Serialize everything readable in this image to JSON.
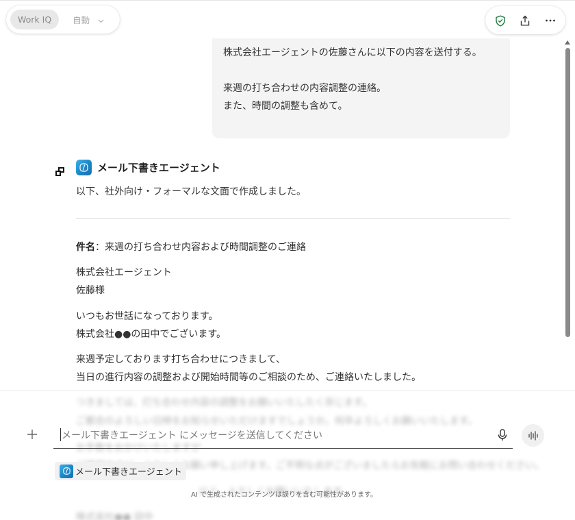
{
  "header": {
    "mode_label": "Work IQ",
    "model_label": "自動",
    "actions": [
      "shield-check-icon",
      "share-icon",
      "more-icon"
    ]
  },
  "user_message": {
    "lines": [
      "株式会社エージェントの佐藤さんに以下の内容を送付する。",
      "来週の打ち合わせの内容調整の連絡。",
      "また、時間の調整も含めて。"
    ]
  },
  "agent": {
    "name": "メール下書きエージェント",
    "intro": "以下、社外向け・フォーマルな文面で作成しました。",
    "subject_label": "件名",
    "subject_text": "：来週の打ち合わせ内容および時間調整のご連絡",
    "body_lines": [
      "株式会社エージェント",
      "佐藤様",
      "いつもお世話になっております。",
      "株式会社●●の田中でございます。",
      "来週予定しております打ち合わせにつきまして、",
      "当日の進行内容の調整および開始時間等のご相談のため、ご連絡いたしました。"
    ],
    "faded_lines": [
      "つきましては、打ち合わせ内容の調整をお願いいたしたく存じます。",
      "ご都合のよろしい日時をお知らせいただけますでしょうか。何卒よろしくお願いいたします。",
      "お手数をおかけいたしますが",
      "ご確認のほど、よろしくお願い申し上げます。ご不明な点がございましたらお気軽にお問い合わせください。",
      "以上、よろしくお願いいたします。",
      "株式会社●● 田中"
    ]
  },
  "composer": {
    "placeholder": "メール下書きエージェント にメッセージを送信してください",
    "agent_chip": "メール下書きエージェント",
    "disclaimer": "AI で生成されたコンテンツは誤りを含む可能性があります。"
  },
  "colors": {
    "agent_gradient_start": "#3db1e6",
    "agent_gradient_end": "#1a6fb4",
    "shield_green": "#1e7b3c",
    "bubble_bg": "#f4f4f4"
  }
}
